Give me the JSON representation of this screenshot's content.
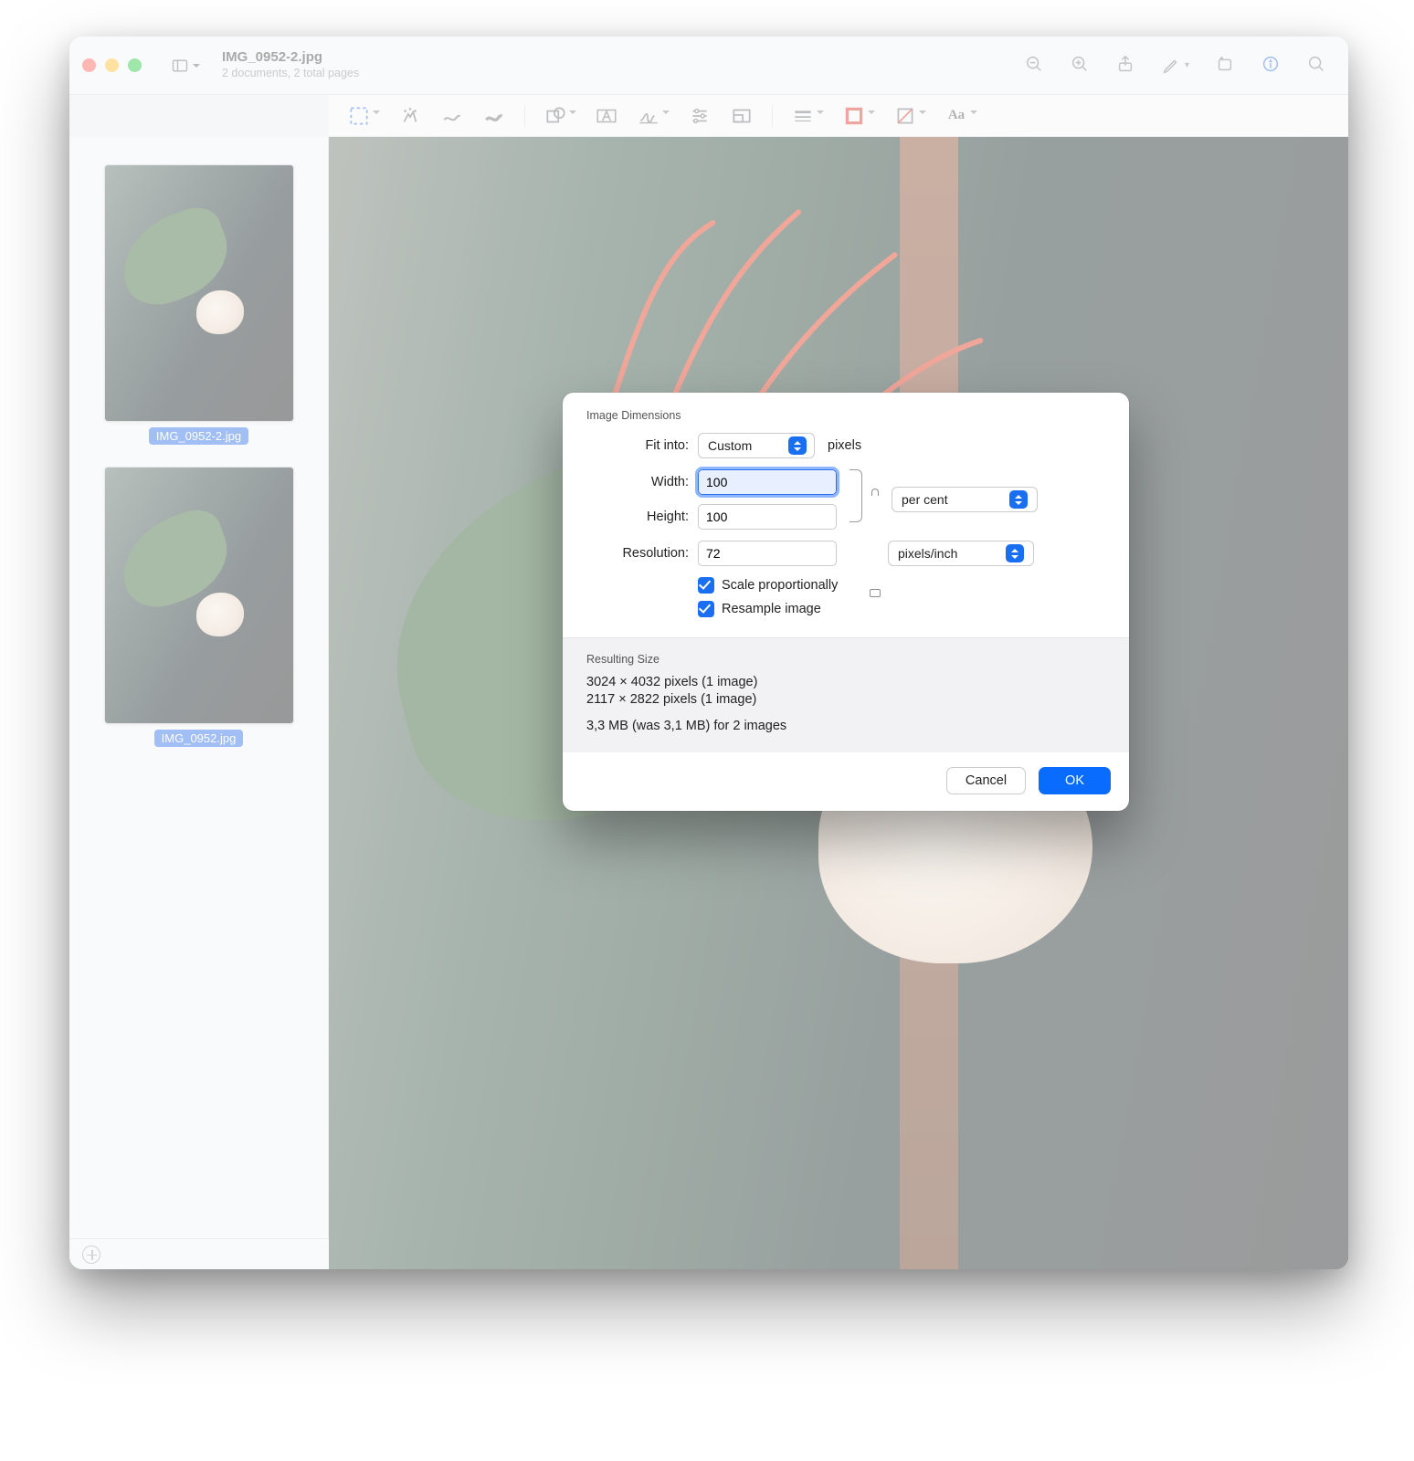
{
  "window": {
    "title": "IMG_0952-2.jpg",
    "subtitle": "2 documents, 2 total pages"
  },
  "sidebar": {
    "thumbs": [
      {
        "label": "IMG_0952-2.jpg"
      },
      {
        "label": "IMG_0952.jpg"
      }
    ]
  },
  "dialog": {
    "section_dimensions_title": "Image Dimensions",
    "fit_into_label": "Fit into:",
    "fit_into_value": "Custom",
    "fit_into_suffix": "pixels",
    "width_label": "Width:",
    "width_value": "100",
    "height_label": "Height:",
    "height_value": "100",
    "wh_unit_value": "per cent",
    "resolution_label": "Resolution:",
    "resolution_value": "72",
    "resolution_unit_value": "pixels/inch",
    "scale_prop_label": "Scale proportionally",
    "scale_prop_checked": true,
    "resample_label": "Resample image",
    "resample_checked": true,
    "section_result_title": "Resulting Size",
    "result_line1": "3024 × 4032 pixels (1 image)",
    "result_line2": "2117 × 2822 pixels (1 image)",
    "result_line3": "3,3 MB (was 3,1 MB) for 2 images",
    "cancel_label": "Cancel",
    "ok_label": "OK"
  }
}
